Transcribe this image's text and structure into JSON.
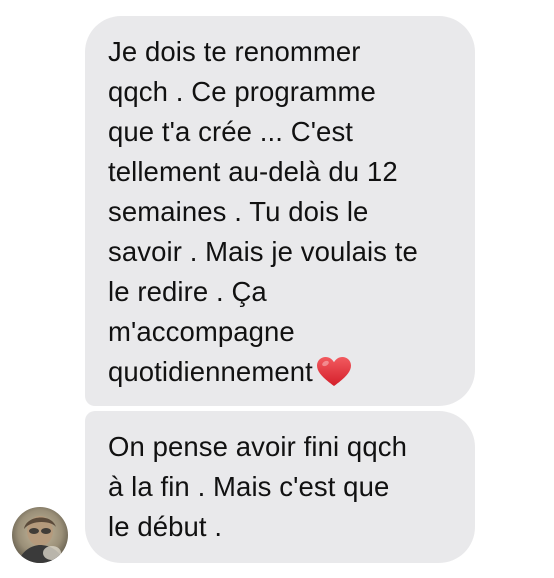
{
  "messages": [
    {
      "text": "Je dois te renommer\nqqch . Ce programme\nque t'a crée ... C'est\ntellement au-delà du 12\nsemaines . Tu dois le\nsavoir . Mais je voulais te\nle redire . Ça\nm'accompagne\nquotidiennement",
      "emoji": "red-heart-icon"
    },
    {
      "text": "On pense avoir fini qqch\nà la fin . Mais c'est que\nle début ."
    }
  ],
  "sender": {
    "avatar": "avatar-photo"
  },
  "colors": {
    "bubble": "#e9e9eb",
    "text": "#111111",
    "heart": "#e8313a"
  }
}
